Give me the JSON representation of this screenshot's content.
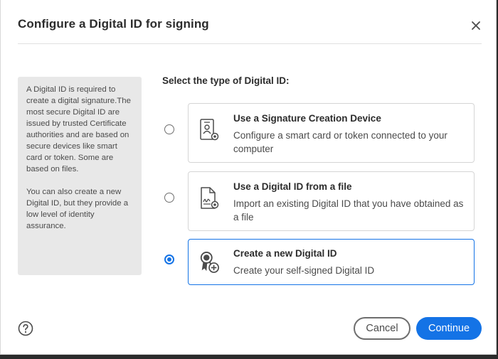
{
  "dialog": {
    "title": "Configure a Digital ID for signing",
    "close_icon": "close-icon",
    "help_icon": "help-circle-icon"
  },
  "info": {
    "paragraph1": "A Digital ID is required to create a digital signature.The most secure Digital ID are issued by trusted Certificate authorities and are based on secure devices like smart card or token. Some are based on files.",
    "paragraph2": "You can also create a new Digital ID, but they provide a low level of identity assurance."
  },
  "select_label": "Select the type of Digital ID:",
  "options": [
    {
      "title": "Use a Signature Creation Device",
      "description": "Configure a smart card or token connected to your computer",
      "icon": "smart-card-icon",
      "selected": false
    },
    {
      "title": "Use a Digital ID from a file",
      "description": "Import an existing Digital ID that you have obtained as a file",
      "icon": "signed-file-icon",
      "selected": false
    },
    {
      "title": "Create a new Digital ID",
      "description": "Create your self-signed Digital ID",
      "icon": "new-certificate-icon",
      "selected": true
    }
  ],
  "buttons": {
    "cancel": "Cancel",
    "continue": "Continue"
  },
  "colors": {
    "accent": "#1473e6",
    "info_background": "#e8e8e8",
    "text": "#2c2c2c"
  }
}
